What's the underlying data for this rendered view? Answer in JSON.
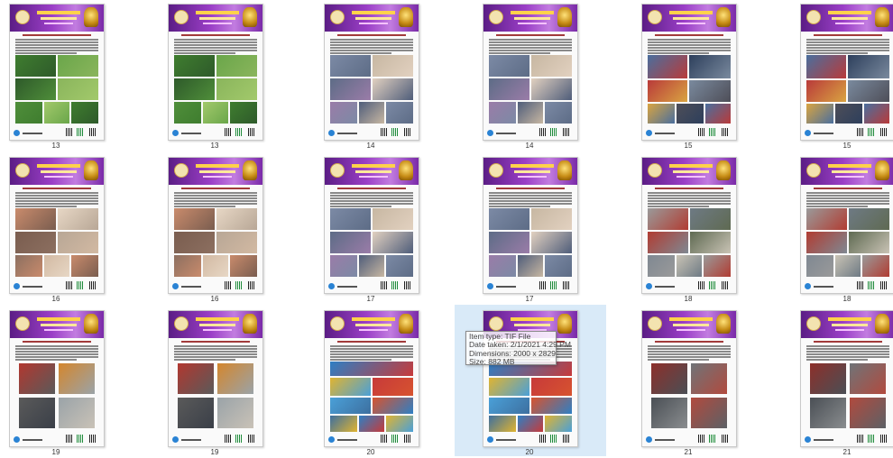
{
  "gallery": {
    "items": [
      {
        "label": "13",
        "theme": "green"
      },
      {
        "label": "13",
        "theme": "green"
      },
      {
        "label": "14",
        "theme": "office"
      },
      {
        "label": "14",
        "theme": "office"
      },
      {
        "label": "15",
        "theme": "repair"
      },
      {
        "label": "15",
        "theme": "repair"
      },
      {
        "label": "16",
        "theme": "meeting"
      },
      {
        "label": "16",
        "theme": "meeting"
      },
      {
        "label": "17",
        "theme": "office"
      },
      {
        "label": "17",
        "theme": "office"
      },
      {
        "label": "18",
        "theme": "trucks"
      },
      {
        "label": "18",
        "theme": "trucks"
      },
      {
        "label": "19",
        "theme": "fire"
      },
      {
        "label": "19",
        "theme": "fire"
      },
      {
        "label": "20",
        "theme": "group"
      },
      {
        "label": "20",
        "theme": "group",
        "selected": true
      },
      {
        "label": "21",
        "theme": "trucks2"
      },
      {
        "label": "21",
        "theme": "trucks2"
      }
    ]
  },
  "tooltip": {
    "item_type": "Item type: TIF File",
    "date_taken": "Date taken: 2/1/2021 4:29 PM",
    "dimensions": "Dimensions: 2000 x 2829",
    "size": "Size: 882 MB"
  },
  "colors": {
    "selection": "#d9eaf8",
    "banner": "#9b3fc7"
  }
}
